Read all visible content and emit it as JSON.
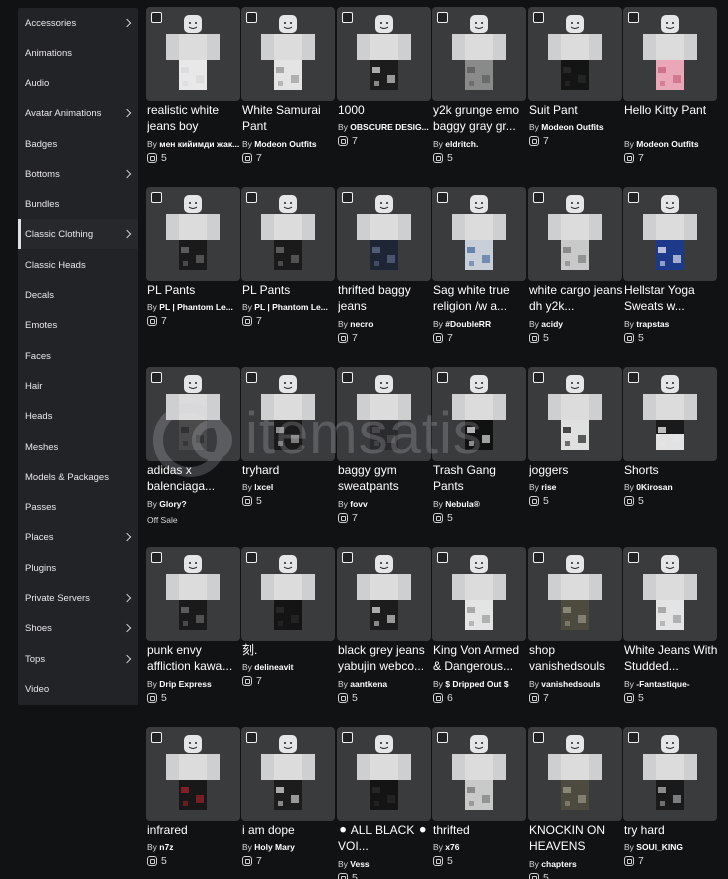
{
  "sidebar": {
    "items": [
      {
        "label": "Accessories",
        "has_submenu": true
      },
      {
        "label": "Animations",
        "has_submenu": false
      },
      {
        "label": "Audio",
        "has_submenu": false
      },
      {
        "label": "Avatar Animations",
        "has_submenu": true
      },
      {
        "label": "Badges",
        "has_submenu": false
      },
      {
        "label": "Bottoms",
        "has_submenu": true
      },
      {
        "label": "Bundles",
        "has_submenu": false
      },
      {
        "label": "Classic Clothing",
        "has_submenu": true,
        "active": true
      },
      {
        "label": "Classic Heads",
        "has_submenu": false
      },
      {
        "label": "Decals",
        "has_submenu": false
      },
      {
        "label": "Emotes",
        "has_submenu": false
      },
      {
        "label": "Faces",
        "has_submenu": false
      },
      {
        "label": "Hair",
        "has_submenu": false
      },
      {
        "label": "Heads",
        "has_submenu": false
      },
      {
        "label": "Meshes",
        "has_submenu": false
      },
      {
        "label": "Models & Packages",
        "has_submenu": false
      },
      {
        "label": "Passes",
        "has_submenu": false
      },
      {
        "label": "Places",
        "has_submenu": true
      },
      {
        "label": "Plugins",
        "has_submenu": false
      },
      {
        "label": "Private Servers",
        "has_submenu": true
      },
      {
        "label": "Shoes",
        "has_submenu": true
      },
      {
        "label": "Tops",
        "has_submenu": true
      },
      {
        "label": "Video",
        "has_submenu": false
      }
    ]
  },
  "watermark": {
    "text": "itemsatis"
  },
  "items": [
    {
      "title": "realistic white jeans boy",
      "creator": "мен кийимди жак...",
      "price": "5",
      "pants": "white"
    },
    {
      "title": "White Samurai Pant",
      "creator": "Modeon Outfits",
      "price": "7",
      "pants": "white-print"
    },
    {
      "title": "1000",
      "creator": "OBSCURE DESIG...",
      "price": "7",
      "pants": "black-white"
    },
    {
      "title": "y2k grunge emo baggy gray gr...",
      "creator": "eldritch.",
      "price": "5",
      "pants": "gray"
    },
    {
      "title": "Suit Pant",
      "creator": "Modeon Outfits",
      "price": "7",
      "pants": "black"
    },
    {
      "title": "Hello Kitty Pant",
      "creator": "Modeon Outfits",
      "price": "7",
      "pants": "pink"
    },
    {
      "title": "PL Pants",
      "creator": "PL | Phantom Le...",
      "price": "7",
      "pants": "black-gray"
    },
    {
      "title": "PL Pants",
      "creator": "PL | Phantom Le...",
      "price": "7",
      "pants": "black-gray"
    },
    {
      "title": "thrifted baggy jeans",
      "creator": "necro",
      "price": "7",
      "pants": "navy"
    },
    {
      "title": "Sag white true religion /w a...",
      "creator": "#DoubleRR",
      "price": "7",
      "pants": "denim"
    },
    {
      "title": "white cargo jeans dh y2k...",
      "creator": "acidy",
      "price": "5",
      "pants": "light-gray"
    },
    {
      "title": "Hellstar Yoga Sweats w...",
      "creator": "trapstas",
      "price": "5",
      "pants": "blue"
    },
    {
      "title": "adidas x balenciaga...",
      "creator": "Glory?",
      "price": "",
      "offsale": "Off Sale",
      "pants": "dark-gray"
    },
    {
      "title": "tryhard",
      "creator": "lxcel",
      "price": "5",
      "pants": "black-graphic"
    },
    {
      "title": "baggy gym sweatpants",
      "creator": "fovv",
      "price": "7",
      "pants": "charcoal"
    },
    {
      "title": "Trash Gang Pants",
      "creator": "Nebula®",
      "price": "5",
      "pants": "black-text"
    },
    {
      "title": "joggers",
      "creator": "rise",
      "price": "5",
      "pants": "white-black"
    },
    {
      "title": "Shorts",
      "creator": "0Kirosan",
      "price": "5",
      "pants": "shorts"
    },
    {
      "title": "punk envy affliction kawa...",
      "creator": "Drip Express",
      "price": "5",
      "pants": "black-gray"
    },
    {
      "title": "刻.",
      "creator": "delineavit",
      "price": "7",
      "pants": "black"
    },
    {
      "title": "black grey jeans yabujin webco...",
      "creator": "aantkena",
      "price": "5",
      "pants": "black-white"
    },
    {
      "title": "King Von Armed & Dangerous...",
      "creator": "$ Dripped Out $",
      "price": "6",
      "pants": "white-print"
    },
    {
      "title": "shop vanishedsouls",
      "creator": "vanishedsouls",
      "price": "7",
      "pants": "camo"
    },
    {
      "title": "White Jeans With Studded...",
      "creator": "-Fantastique-",
      "price": "5",
      "pants": "white-print"
    },
    {
      "title": "infrared",
      "creator": "n7z",
      "price": "5",
      "pants": "red-black"
    },
    {
      "title": "i am dope",
      "creator": "Holy Mary",
      "price": "7",
      "pants": "black-white"
    },
    {
      "title": "⚫ ALL BLACK ⚫ VOI...",
      "creator": "Vess",
      "price": "5",
      "pants": "black"
    },
    {
      "title": "thrifted",
      "creator": "x76",
      "price": "5",
      "pants": "light-gray"
    },
    {
      "title": "KNOCKIN ON HEAVENS DOOR",
      "creator": "chapters",
      "price": "5",
      "pants": "camo"
    },
    {
      "title": "try hard",
      "creator": "SOUl_KING",
      "price": "7",
      "pants": "black-graphic"
    }
  ]
}
